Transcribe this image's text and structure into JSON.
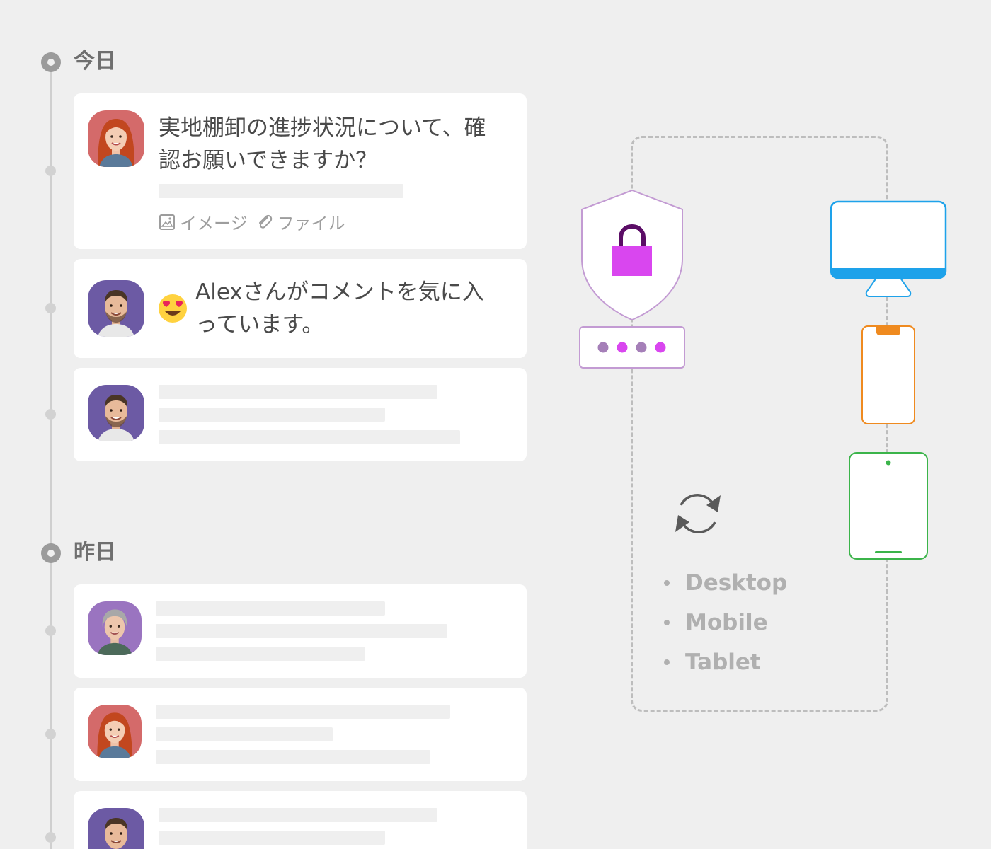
{
  "timeline": {
    "today_label": "今日",
    "yesterday_label": "昨日"
  },
  "message_card": {
    "text": "実地棚卸の進捗状況について、確認お願いできますか？",
    "attachments": {
      "image_label": "イメージ",
      "file_label": "ファイル"
    }
  },
  "like_card": {
    "text": "Alexさんがコメントを気に入っています。",
    "emoji_icon": "heart-eyes-emoji"
  },
  "sync_panel": {
    "devices": [
      "Desktop",
      "Mobile",
      "Tablet"
    ]
  },
  "colors": {
    "lock": "#d946ef",
    "shield_stroke": "#c39bd3",
    "desktop": "#1ea2ea",
    "mobile": "#ef8a1f",
    "tablet": "#3bb44a"
  }
}
